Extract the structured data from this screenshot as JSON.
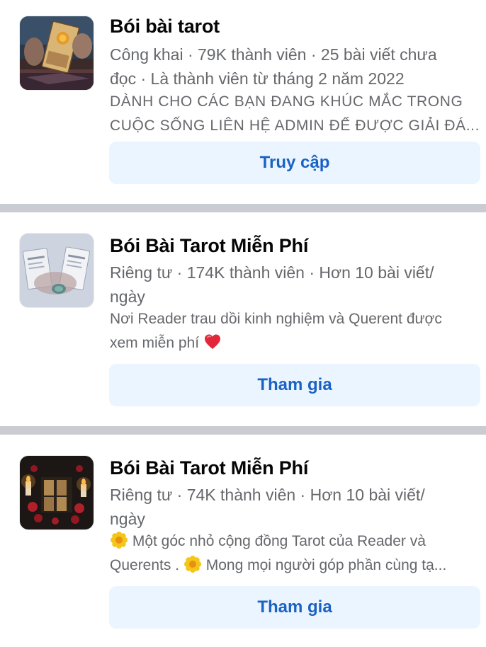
{
  "groups": [
    {
      "name": "Bói bài tarot",
      "meta_lines": [
        "Công khai · 79K thành viên · 25 bài viết chưa",
        "đọc · Là thành viên từ tháng 2 năm 2022"
      ],
      "description_lines": [
        "DÀNH CHO CÁC BẠN ĐANG KHÚC MẮC TRONG",
        "CUỘC SỐNG LIÊN HỆ ADMIN ĐỂ ĐƯỢC GIẢI ĐÁ..."
      ],
      "button_label": "Truy cập",
      "thumbnail": "tarot-card-sun-photo"
    },
    {
      "name": "Bói Bài Tarot Miễn Phí",
      "meta_lines": [
        "Riêng tư · 174K thành viên · Hơn 10 bài viết/",
        "ngày"
      ],
      "description_lines": [
        "Nơi Reader trau dồi kinh nghiệm và Querent được",
        "xem miễn phí"
      ],
      "description_emoji": "red-heart-icon",
      "button_label": "Tham gia",
      "thumbnail": "tarot-cards-in-hands-photo"
    },
    {
      "name": "Bói Bài Tarot Miễn Phí",
      "meta_lines": [
        "Riêng tư · 74K thành viên · Hơn 10 bài viết/",
        "ngày"
      ],
      "description_parts": {
        "line1": "Một góc nhỏ cộng đồng Tarot của Reader và",
        "line2a": "Querents .",
        "line2b": "Mong mọi người góp phần cùng tạ..."
      },
      "description_emoji": "blossom-icon",
      "button_label": "Tham gia",
      "thumbnail": "tarot-cards-candles-roses-photo"
    }
  ],
  "colors": {
    "title": "#050505",
    "secondary_text": "#65676b",
    "button_bg": "#ebf5ff",
    "button_text": "#1a62c6",
    "divider": "#c9ccd1"
  }
}
